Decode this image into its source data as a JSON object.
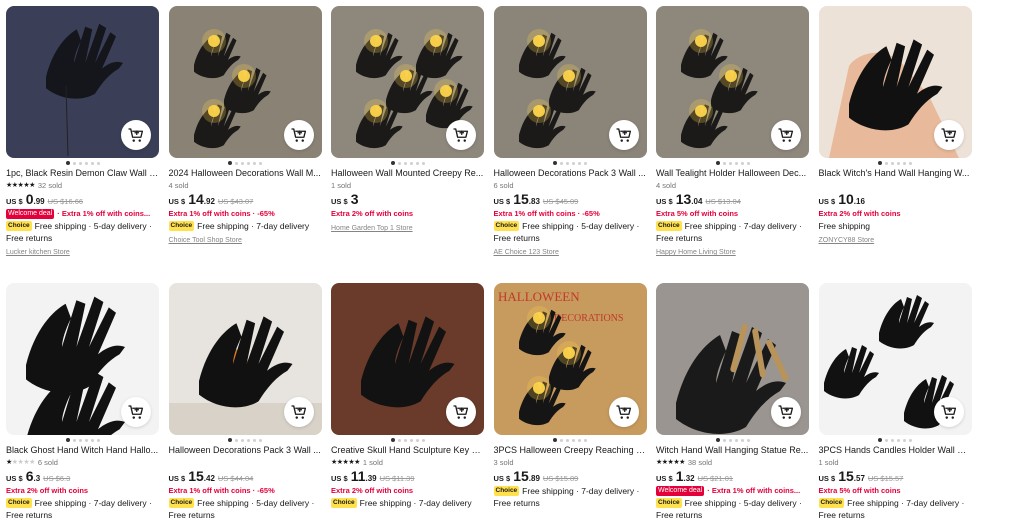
{
  "colors": {
    "accent": "#e4003a",
    "choice_badge": "#ffe14d",
    "text": "#191919",
    "muted": "#757575"
  },
  "cart_icon": "add-to-cart-icon",
  "products": [
    {
      "title": "1pc, Black Resin Demon Claw Wall H...",
      "rating_stars": 5,
      "sold": "32 sold",
      "currency": "US $",
      "price_int": "0",
      "price_dec": ".99",
      "old_price": "US $16.66",
      "deal_badge": "Welcome deal",
      "promo": "· Extra 1% off with coins...",
      "choice": "Choice",
      "shipping": "Free shipping · 5-day delivery ·",
      "returns": "Free returns",
      "store": "Lucker kitchen Store"
    },
    {
      "title": "2024 Halloween Decorations Wall M...",
      "rating_stars": 0,
      "sold": "4 sold",
      "currency": "US $",
      "price_int": "14",
      "price_dec": ".92",
      "old_price": "US $43.07",
      "deal_badge": "",
      "promo": "Extra 1% off with coins · -65%",
      "choice": "Choice",
      "shipping": "Free shipping · 7-day delivery",
      "returns": "",
      "store": "Choice Tool Shop Store"
    },
    {
      "title": "Halloween Wall Mounted Creepy Re...",
      "rating_stars": 0,
      "sold": "1 sold",
      "currency": "US $",
      "price_int": "3",
      "price_dec": "",
      "old_price": "",
      "deal_badge": "",
      "promo": "Extra 2% off with coins",
      "choice": "",
      "shipping": "",
      "returns": "",
      "store": "Home Garden Top 1 Store"
    },
    {
      "title": "Halloween Decorations Pack 3 Wall ...",
      "rating_stars": 0,
      "sold": "6 sold",
      "currency": "US $",
      "price_int": "15",
      "price_dec": ".83",
      "old_price": "US $45.09",
      "deal_badge": "",
      "promo": "Extra 1% off with coins · -65%",
      "choice": "Choice",
      "shipping": "Free shipping · 5-day delivery ·",
      "returns": "Free returns",
      "store": "AE Choice 123 Store"
    },
    {
      "title": "Wall Tealight Holder Halloween Dec...",
      "rating_stars": 0,
      "sold": "4 sold",
      "currency": "US $",
      "price_int": "13",
      "price_dec": ".04",
      "old_price": "US $13.04",
      "deal_badge": "",
      "promo": "Extra 5% off with coins",
      "choice": "Choice",
      "shipping": "Free shipping · 7-day delivery ·",
      "returns": "Free returns",
      "store": "Happy Home Living Store"
    },
    {
      "title": "Black Witch's Hand Wall Hanging W...",
      "rating_stars": 0,
      "sold": "",
      "currency": "US $",
      "price_int": "10",
      "price_dec": ".16",
      "old_price": "",
      "deal_badge": "",
      "promo": "Extra 2% off with coins",
      "choice": "",
      "shipping": "Free shipping",
      "returns": "",
      "store": "ZONYCY88 Store"
    },
    {
      "title": "Black Ghost Hand Witch Hand Hallo...",
      "rating_stars": 1,
      "sold": "6 sold",
      "currency": "US $",
      "price_int": "6",
      "price_dec": ".3",
      "old_price": "US $6.3",
      "deal_badge": "",
      "promo": "Extra 2% off with coins",
      "choice": "Choice",
      "shipping": "Free shipping · 7-day delivery ·",
      "returns": "Free returns",
      "store": ""
    },
    {
      "title": "Halloween Decorations Pack 3 Wall ...",
      "rating_stars": 0,
      "sold": "",
      "currency": "US $",
      "price_int": "15",
      "price_dec": ".42",
      "old_price": "US $44.04",
      "deal_badge": "",
      "promo": "Extra 1% off with coins · -65%",
      "choice": "Choice",
      "shipping": "Free shipping · 5-day delivery ·",
      "returns": "Free returns",
      "store": ""
    },
    {
      "title": "Creative Skull Hand Sculpture Key S...",
      "rating_stars": 5,
      "sold": "1 sold",
      "currency": "US $",
      "price_int": "11",
      "price_dec": ".39",
      "old_price": "US $11.39",
      "deal_badge": "",
      "promo": "Extra 2% off with coins",
      "choice": "Choice",
      "shipping": "Free shipping · 7-day delivery",
      "returns": "",
      "store": ""
    },
    {
      "title": "3PCS Halloween Creepy Reaching H...",
      "rating_stars": 0,
      "sold": "3 sold",
      "currency": "US $",
      "price_int": "15",
      "price_dec": ".89",
      "old_price": "US $15.89",
      "deal_badge": "",
      "promo": "",
      "choice": "Choice",
      "shipping": "Free shipping · 7-day delivery ·",
      "returns": "Free returns",
      "store": ""
    },
    {
      "title": "Witch Hand Wall Hanging Statue Re...",
      "rating_stars": 5,
      "sold": "38 sold",
      "currency": "US $",
      "price_int": "1",
      "price_dec": ".32",
      "old_price": "US $21.01",
      "deal_badge": "Welcome deal",
      "promo": "· Extra 1% off with coins...",
      "choice": "Choice",
      "shipping": "Free shipping · 5-day delivery ·",
      "returns": "Free returns",
      "store": ""
    },
    {
      "title": "3PCS Hands Candles Holder Wall Ha...",
      "rating_stars": 0,
      "sold": "1 sold",
      "currency": "US $",
      "price_int": "15",
      "price_dec": ".57",
      "old_price": "US $15.57",
      "deal_badge": "",
      "promo": "Extra 5% off with coins",
      "choice": "Choice",
      "shipping": "Free shipping · 7-day delivery ·",
      "returns": "Free returns",
      "store": ""
    }
  ]
}
